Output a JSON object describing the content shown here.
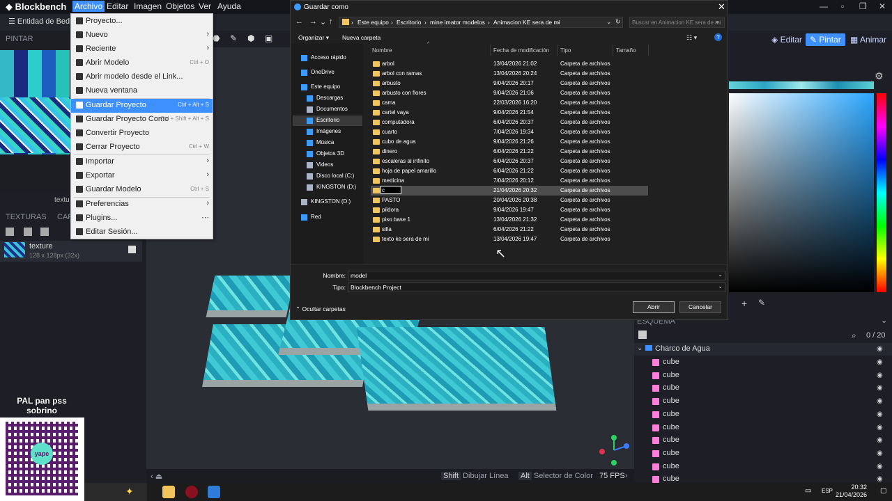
{
  "app": {
    "name": "Blockbench",
    "menus": [
      "Archivo",
      "Editar",
      "Imagen",
      "Objetos",
      "Ver",
      "Ayuda"
    ],
    "tab_label": "Entidad de Bedro",
    "paint_label": "PINTAR",
    "uv_label": "textu",
    "textures_panel": {
      "title": "TEXTURAS",
      "second_tab": "CAP"
    },
    "texture": {
      "name": "texture",
      "size": "128 x 128px (32x)"
    },
    "modes": {
      "edit": "Editar",
      "paint": "Pintar",
      "animate": "Animar"
    },
    "outliner": {
      "title": "ESQUEMA",
      "count": "0 / 20",
      "group": "Charco de Agua",
      "cubes": [
        "cube",
        "cube",
        "cube",
        "cube",
        "cube",
        "cube",
        "cube",
        "cube",
        "cube",
        "cube"
      ]
    },
    "status": {
      "shift_key": "Shift",
      "shift_action": "Dibujar Línea",
      "alt_key": "Alt",
      "alt_action": "Selector de Color",
      "fps": "75 FPS"
    },
    "colors": {
      "accent": "#3e90ff",
      "cube_icon": "#ff7edb"
    }
  },
  "archivo_menu": {
    "items": [
      {
        "label": "Proyecto...",
        "shortcut": "",
        "submenu": false
      },
      {
        "label": "Nuevo",
        "shortcut": "",
        "submenu": true
      },
      {
        "label": "Reciente",
        "shortcut": "",
        "submenu": true
      },
      {
        "label": "Abrir Modelo",
        "shortcut": "Ctrl + O",
        "submenu": false
      },
      {
        "label": "Abrir modelo desde el Link...",
        "shortcut": "",
        "submenu": false
      },
      {
        "label": "Nueva ventana",
        "shortcut": "",
        "submenu": false
      },
      {
        "label": "Guardar Proyecto",
        "shortcut": "Ctrl + Alt + S",
        "submenu": false
      },
      {
        "label": "Guardar Proyecto Como",
        "shortcut": "Ctrl + Shift + Alt + S",
        "submenu": false
      },
      {
        "label": "Convertir Proyecto",
        "shortcut": "",
        "submenu": false
      },
      {
        "label": "Cerrar Proyecto",
        "shortcut": "Ctrl + W",
        "submenu": false
      },
      {
        "label": "Importar",
        "shortcut": "",
        "submenu": true
      },
      {
        "label": "Exportar",
        "shortcut": "",
        "submenu": true
      },
      {
        "label": "Guardar Modelo",
        "shortcut": "Ctrl + S",
        "submenu": false
      },
      {
        "label": "Preferencias",
        "shortcut": "",
        "submenu": true
      },
      {
        "label": "Plugins...",
        "shortcut": "",
        "submenu": false
      },
      {
        "label": "Editar Sesión...",
        "shortcut": "",
        "submenu": false
      }
    ],
    "selected_index": 6
  },
  "save_dialog": {
    "title": "Guardar como",
    "breadcrumb": [
      "Este equipo",
      "Escritorio",
      "mine imator modelos",
      "Animacion KE sera de mi"
    ],
    "search_placeholder": "Buscar en Animacion KE sera de mi",
    "toolbar": {
      "organize": "Organizar",
      "new_folder": "Nueva carpeta"
    },
    "nav": [
      {
        "label": "Acceso rápido",
        "icon": "star-icon"
      },
      {
        "label": "OneDrive",
        "icon": "cloud-icon"
      },
      {
        "label": "Este equipo",
        "icon": "computer-icon"
      },
      {
        "label": "Descargas",
        "icon": "download-icon"
      },
      {
        "label": "Documentos",
        "icon": "document-icon"
      },
      {
        "label": "Escritorio",
        "icon": "desktop-icon"
      },
      {
        "label": "Imágenes",
        "icon": "image-icon"
      },
      {
        "label": "Música",
        "icon": "music-icon"
      },
      {
        "label": "Objetos 3D",
        "icon": "cube-icon"
      },
      {
        "label": "Videos",
        "icon": "video-icon"
      },
      {
        "label": "Disco local (C:)",
        "icon": "drive-icon"
      },
      {
        "label": "KINGSTON (D:)",
        "icon": "drive-icon"
      },
      {
        "label": "KINGSTON (D:)",
        "icon": "drive-icon"
      },
      {
        "label": "Red",
        "icon": "network-icon"
      }
    ],
    "columns": [
      "Nombre",
      "Fecha de modificación",
      "Tipo",
      "Tamaño"
    ],
    "files": [
      {
        "name": "arbol",
        "date": "13/04/2026 21:02",
        "type": "Carpeta de archivos"
      },
      {
        "name": "arbol con ramas",
        "date": "13/04/2026 20:24",
        "type": "Carpeta de archivos"
      },
      {
        "name": "arbusto",
        "date": "9/04/2026 20:17",
        "type": "Carpeta de archivos"
      },
      {
        "name": "arbusto con flores",
        "date": "9/04/2026 21:06",
        "type": "Carpeta de archivos"
      },
      {
        "name": "cama",
        "date": "22/03/2026 16:20",
        "type": "Carpeta de archivos"
      },
      {
        "name": "cartel vaya",
        "date": "9/04/2026 21:54",
        "type": "Carpeta de archivos"
      },
      {
        "name": "computadora",
        "date": "6/04/2026 20:37",
        "type": "Carpeta de archivos"
      },
      {
        "name": "cuarto",
        "date": "7/04/2026 19:34",
        "type": "Carpeta de archivos"
      },
      {
        "name": "cubo de agua",
        "date": "9/04/2026 21:26",
        "type": "Carpeta de archivos"
      },
      {
        "name": "dinero",
        "date": "6/04/2026 21:22",
        "type": "Carpeta de archivos"
      },
      {
        "name": "escaleras al infinito",
        "date": "6/04/2026 20:37",
        "type": "Carpeta de archivos"
      },
      {
        "name": "hoja de papel amarillo",
        "date": "6/04/2026 21:22",
        "type": "Carpeta de archivos"
      },
      {
        "name": "medicina",
        "date": "7/04/2026 20:12",
        "type": "Carpeta de archivos"
      },
      {
        "name": "c",
        "date": "21/04/2026 20:32",
        "type": "Carpeta de archivos"
      },
      {
        "name": "PASTO",
        "date": "20/04/2026 20:38",
        "type": "Carpeta de archivos"
      },
      {
        "name": "pildora",
        "date": "9/04/2026 19:47",
        "type": "Carpeta de archivos"
      },
      {
        "name": "piso base 1",
        "date": "13/04/2026 21:32",
        "type": "Carpeta de archivos"
      },
      {
        "name": "silla",
        "date": "6/04/2026 21:22",
        "type": "Carpeta de archivos"
      },
      {
        "name": "texto ke sera de mi",
        "date": "13/04/2026 19:47",
        "type": "Carpeta de archivos"
      }
    ],
    "selected_file_index": 13,
    "filename_label": "Nombre:",
    "filename_value": "model",
    "type_label": "Tipo:",
    "type_value": "Blockbench Project",
    "hide_folders": "Ocultar carpetas",
    "open_button": "Abrir",
    "cancel_button": "Cancelar"
  },
  "overlay": {
    "caption_line1": "PAL pan pss",
    "caption_line2": "sobrino",
    "qr_logo_text": "yape"
  },
  "taskbar": {
    "lang": "ESP",
    "time": "20:32",
    "date": "21/04/2026"
  }
}
